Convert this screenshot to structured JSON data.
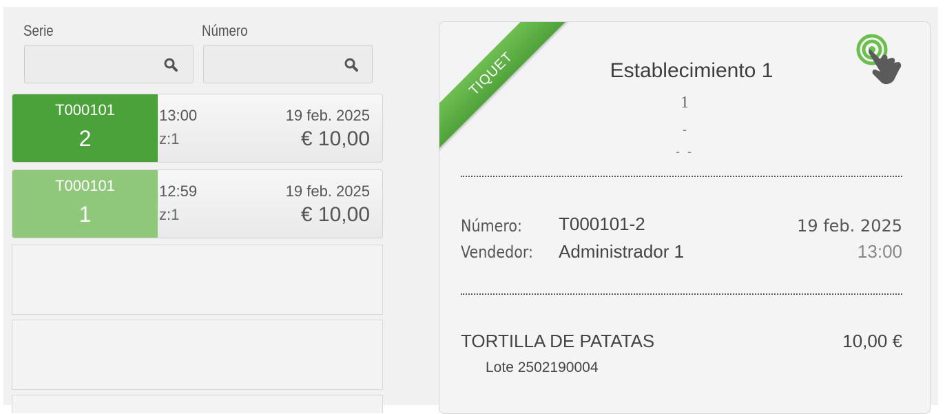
{
  "search": {
    "serie_label": "Serie",
    "numero_label": "Número",
    "serie_value": "",
    "numero_value": ""
  },
  "tickets": [
    {
      "serie": "T000101",
      "number": "2",
      "time": "13:00",
      "z": "z:1",
      "date": "19 feb. 2025",
      "amount": "€ 10,00",
      "color": "#4ca23a",
      "selected": true
    },
    {
      "serie": "T000101",
      "number": "1",
      "time": "12:59",
      "z": "z:1",
      "date": "19 feb. 2025",
      "amount": "€ 10,00",
      "color": "#8fc87a",
      "selected": false
    }
  ],
  "receipt": {
    "ribbon": "TIQUET",
    "establishment": "Establecimiento 1",
    "line1": "1",
    "line2": "-",
    "line3": "- -",
    "numero_label": "Número:",
    "numero_value": "T000101-2",
    "date": "19 feb. 2025",
    "vendedor_label": "Vendedor:",
    "vendedor_value": "Administrador 1",
    "time": "13:00",
    "item": {
      "name": "TORTILLA DE PATATAS",
      "price": "10,00 €",
      "lot": "Lote 2502190004"
    }
  },
  "icons": {
    "search": "search-icon",
    "touch": "touch-tap-icon"
  },
  "colors": {
    "accent": "#4ca23a",
    "accent_light": "#8fc87a"
  }
}
